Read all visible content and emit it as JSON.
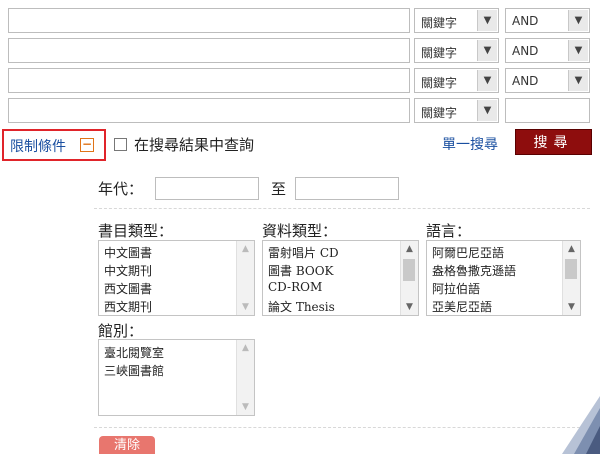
{
  "rows": [
    {
      "field": "關鍵字",
      "operator": "AND"
    },
    {
      "field": "關鍵字",
      "operator": "AND"
    },
    {
      "field": "關鍵字",
      "operator": "AND"
    },
    {
      "field": "關鍵字",
      "operator": ""
    }
  ],
  "toolbar": {
    "filter_label": "限制條件",
    "filter_toggle": "−",
    "within_results_label": "在搜尋結果中查詢",
    "single_search_link": "單一搜尋",
    "search_button": "搜尋"
  },
  "year": {
    "label": "年代：",
    "to_label": "至"
  },
  "lists": {
    "bib_type": {
      "label": "書目類型：",
      "items": [
        "中文圖書",
        "中文期刊",
        "西文圖書",
        "西文期刊"
      ]
    },
    "material_type": {
      "label": "資料類型：",
      "items": [
        "雷射唱片 CD",
        "圖書 BOOK",
        "CD-ROM",
        "論文 Thesis"
      ]
    },
    "language": {
      "label": "語言：",
      "items": [
        "阿爾巴尼亞語",
        "盎格魯撒克遜語",
        "阿拉伯語",
        "亞美尼亞語"
      ]
    },
    "branch": {
      "label": "館別：",
      "items": [
        "臺北閱覽室",
        "三峽圖書館"
      ]
    }
  },
  "actions": {
    "clear_button": "清除"
  },
  "colors": {
    "search_button_bg": "#8e0d0d",
    "link": "#1a4fa0",
    "filter_highlight": "#e0242a",
    "clear_button_bg": "#e8766e"
  },
  "icons": {
    "dropdown": "chevron-down-icon",
    "toggle": "minus-box-icon",
    "scroll_up": "arrow-up-icon",
    "scroll_down": "arrow-down-icon"
  }
}
